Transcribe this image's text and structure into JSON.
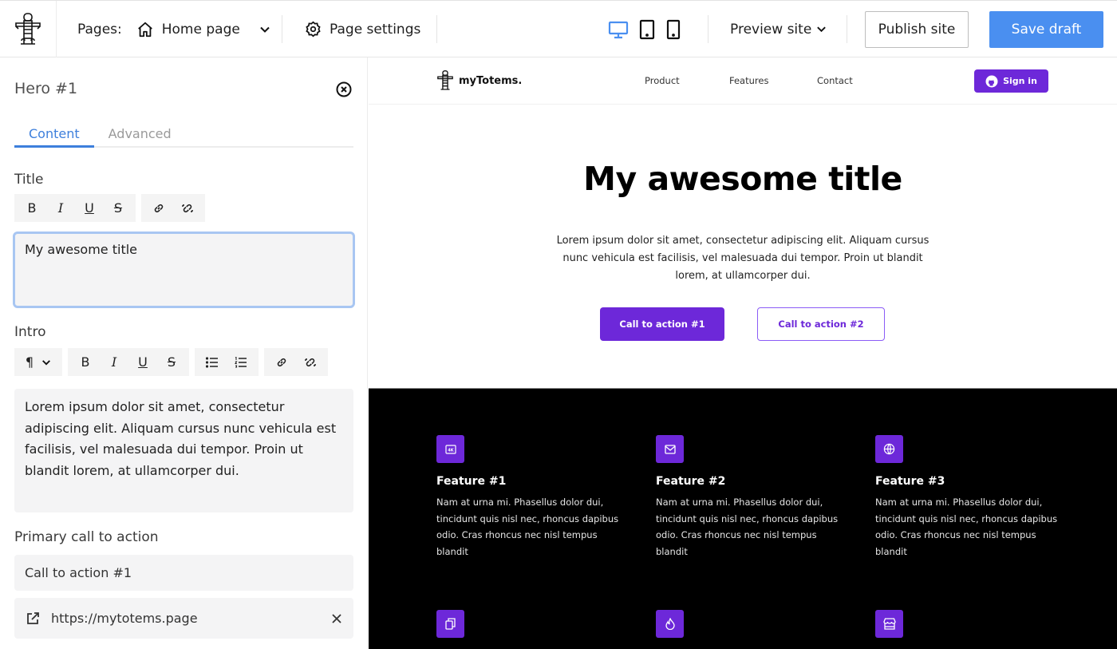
{
  "topbar": {
    "logo": "totem-logo",
    "pages_label": "Pages:",
    "current_page": "Home page",
    "page_settings_label": "Page settings",
    "devices": [
      "desktop",
      "tablet",
      "mobile"
    ],
    "active_device": "desktop",
    "preview_label": "Preview site",
    "publish_label": "Publish site",
    "save_label": "Save draft",
    "accent_color": "#4a8ff0"
  },
  "panel": {
    "title": "Hero #1",
    "tabs": [
      {
        "label": "Content",
        "active": true
      },
      {
        "label": "Advanced",
        "active": false
      }
    ],
    "title_field": {
      "label": "Title",
      "value": "My awesome title",
      "toolbar": [
        "bold",
        "italic",
        "underline",
        "strikethrough",
        "link",
        "unlink"
      ]
    },
    "intro_field": {
      "label": "Intro",
      "value": "Lorem ipsum dolor sit amet, consectetur adipiscing elit. Aliquam cursus nunc vehicula est facilisis, vel malesuada dui tempor. Proin ut blandit lorem, at ullamcorper dui.",
      "toolbar": [
        "paragraph",
        "bold",
        "italic",
        "underline",
        "strikethrough",
        "bullet-list",
        "numbered-list",
        "link",
        "unlink"
      ]
    },
    "primary_cta": {
      "label": "Primary call to action",
      "text_value": "Call to action #1",
      "url_value": "https://mytotems.page"
    }
  },
  "site": {
    "brand": "myTotems.",
    "nav": [
      "Product",
      "Features",
      "Contact"
    ],
    "signin_label": "Sign in",
    "brand_color": "#6d28d9",
    "hero": {
      "title": "My awesome title",
      "intro": "Lorem ipsum dolor sit amet, consectetur adipiscing elit. Aliquam cursus nunc vehicula est facilisis, vel malesuada dui tempor. Proin ut blandit lorem, at ullamcorper dui.",
      "cta1": "Call to action #1",
      "cta2": "Call to action #2"
    },
    "features": [
      {
        "icon": "4k-icon",
        "title": "Feature #1",
        "desc": "Nam at urna mi. Phasellus dolor dui, tincidunt quis nisl nec, rhoncus dapibus odio. Cras rhoncus nec nisl tempus blandit"
      },
      {
        "icon": "mail-icon",
        "title": "Feature #2",
        "desc": "Nam at urna mi. Phasellus dolor dui, tincidunt quis nisl nec, rhoncus dapibus odio. Cras rhoncus nec nisl tempus blandit"
      },
      {
        "icon": "globe-icon",
        "title": "Feature #3",
        "desc": "Nam at urna mi. Phasellus dolor dui, tincidunt quis nisl nec, rhoncus dapibus odio. Cras rhoncus nec nisl tempus blandit"
      }
    ],
    "more_feature_icons": [
      "copy-icon",
      "flame-icon",
      "store-icon"
    ]
  }
}
